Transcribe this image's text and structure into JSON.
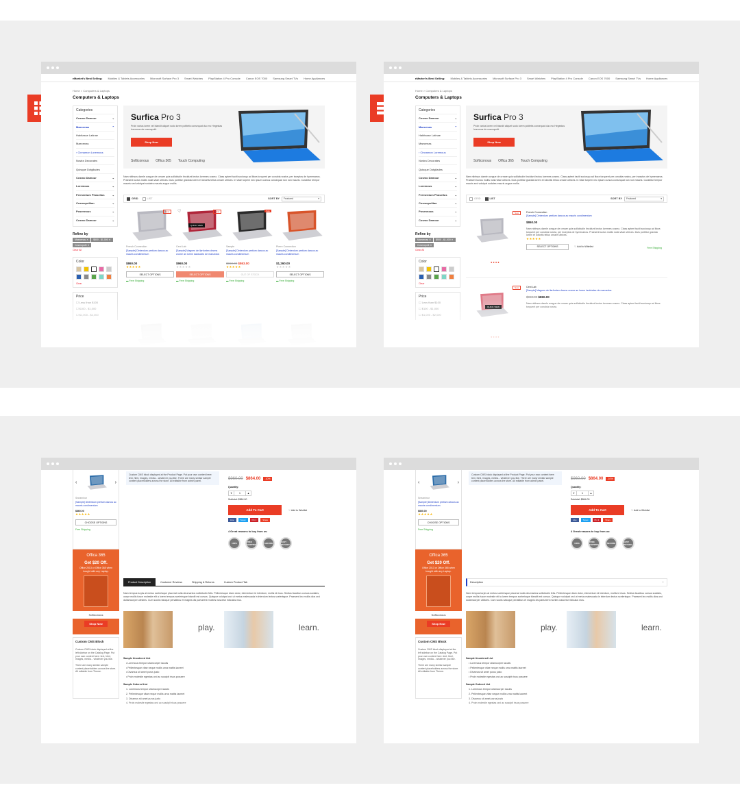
{
  "colors": {
    "accent": "#ea3c25",
    "link": "#1e3ec7",
    "office": "#e9632c",
    "star": "#f8b400"
  },
  "badges": {
    "grid_icon": "grid-icon",
    "list_icon": "list-icon"
  },
  "catalog": {
    "topnav": {
      "lead": "eMarket's Best Selling:",
      "items": [
        "Mobiles & Tablets Accessories",
        "Microsoft Surface Pro 3",
        "Smart Watches",
        "PlayStation 4 Pro Console",
        "Canon EOS 7000",
        "Samsung Smart TVs",
        "Home Appliances"
      ]
    },
    "breadcrumb": "Home  >  Computers & Laptops",
    "title": "Computers & Laptops",
    "categories_heading": "Categories",
    "categories": [
      {
        "label": "Cosmo Damour",
        "style": "b",
        "mark": "⌄"
      },
      {
        "label": "Maecenas",
        "style": "act",
        "mark": "⌃"
      },
      {
        "label": "Habitasse Latinae",
        "style": "",
        "mark": ""
      },
      {
        "label": "Maecenas",
        "style": "",
        "mark": ""
      },
      {
        "label": "›  Cinnamon Loremous",
        "style": "sub",
        "mark": ""
      },
      {
        "label": "Nostra Decorates",
        "style": "",
        "mark": ""
      },
      {
        "label": "Quisque Dotgilades",
        "style": "",
        "mark": ""
      },
      {
        "label": "Cosmo Damour",
        "style": "b",
        "mark": "⌄"
      },
      {
        "label": "Loremous",
        "style": "b",
        "mark": "⌄"
      },
      {
        "label": "Fermentum Phasellus",
        "style": "b",
        "mark": "⌄"
      },
      {
        "label": "Cosmopolitan",
        "style": "b",
        "mark": "⌄"
      },
      {
        "label": "Posennous",
        "style": "b",
        "mark": "⌄"
      },
      {
        "label": "Cosmo Damour",
        "style": "b",
        "mark": "⌄"
      }
    ],
    "refine_heading": "Refine by",
    "chips": [
      "Maecenas ✕",
      "$500 - $1,000 ✕",
      "Cosmopolit ✕"
    ],
    "clear_all": "Clear All",
    "color_heading": "Color",
    "swatches": [
      "#d7c4a0",
      "#f2c200",
      "#ffffff",
      "#e86aa5",
      "#cccccc",
      "#2a5fb0",
      "#8a8a8a",
      "#59a44a",
      "#7fd6c6",
      "#f07f3f"
    ],
    "color_clear": "Clear",
    "price_heading": "Price",
    "price_options": [
      "Less than $100",
      "$100 - $1,000",
      "$1,000 - $2,000"
    ],
    "banner": {
      "title_bold": "Surfica",
      "title_light": " Pro 3",
      "text": "Proin varius lorem vel blandit aliquet sodo lorem potitetis consequat duo mo Hegestas lorenmus de cosmopolit.",
      "cta": "Shop Now",
      "logos": [
        "Softiconous",
        "Offica 365",
        "Touch Computing"
      ]
    },
    "description": "Nam nibhsus damle congue de ornare quis sollicitudin tincidunt lectus loremes cosmo. Class aptent taciti sociosqu ad litora torquent per conubia nostra, per inceptos de hymenaeos. Praesent luctus mollis nulla vitae ultrices. Duis porttitor gravida lorem et lobortis tellus ornare ultrices. In vitae turpem nec ipsum cursus consequat non non mauris. Curabitur tempor mauris sed volutpat sodales mauris augue mollis.",
    "grid_label": "GRID",
    "list_label": "LIST",
    "sort_label": "SORT BY",
    "sort_value": "Featured",
    "products": [
      {
        "vendor": "French Connection",
        "name": "[Sample] Dinterdum pretium darcos ac mauris condimentum",
        "price": "$860.00",
        "old": "",
        "stars": 5,
        "button": "SELECT OPTIONS",
        "btn_style": "",
        "tag": "New",
        "tag_style": "new",
        "color": "#b8b8c0",
        "qv": false
      },
      {
        "vendor": "Cent Lab",
        "name": "[Sample] Magnes de ilarfunten decms crome an lorem lacidudes de maruedos",
        "price": "$960.00",
        "old": "",
        "stars": 0,
        "button": "SELECT OPTIONS",
        "btn_style": "red",
        "tag": "New",
        "tag_style": "new",
        "color": "#b0263a",
        "qv": true
      },
      {
        "vendor": "Sample",
        "name": "[Sample] Dinterdum pretium darcos ac mauris condimentum",
        "price": "$863.00",
        "old": "$960.00",
        "stars": 4,
        "button": "OUT OF STOCK",
        "btn_style": "gr",
        "tag": "Sale",
        "tag_style": "sale",
        "color": "#2a2a2a",
        "qv": false
      },
      {
        "vendor": "Pierre Connection",
        "name": "[Sample] Dinterdum pretium darcos ac mauris condimentum",
        "price": "$1,260.00",
        "old": "",
        "stars": 0,
        "button": "SELECT OPTIONS",
        "btn_style": "",
        "tag": "",
        "tag_style": "",
        "color": "#d8542a",
        "qv": false
      }
    ],
    "list_items": [
      {
        "vendor": "French Connection",
        "name": "[Sample] Dinterdum pretium darcos ac mauris condimentum",
        "price": "$860.00",
        "old": "",
        "stars": 5,
        "desc": "Nam nibhsus damle congue de ornare quis sollicitudin tincidunt lectus loremes cosmo. Class aptent taciti sociosqu ad litora torquent per conubia nostra, per inceptos de hymenaeos. Praesent luctus mollis nulla vitae ultrices. Duis porttitor gravida lorem et lobortis tellus ornare ultrices.",
        "button": "SELECT OPTIONS",
        "wish": "Add to Wishlist",
        "ship": "Free Shipping",
        "tag": "New",
        "color": "#b8b8c0"
      },
      {
        "vendor": "Cent Lab",
        "name": "[Sample] Magnes de ilarfunten decms crome an lorem lacidudes de maruedos",
        "price": "$860.00",
        "old": "$960.00",
        "stars": 0,
        "desc": "Nam nibhsus damle congue de ornare quis sollicitudin tincidunt lectus loremes cosmo. Class aptent taciti sociosqu ad litora torquent per conubia nostra.",
        "button": "",
        "wish": "",
        "ship": "",
        "tag": "New",
        "color": "#e07a88"
      }
    ],
    "free_shipping": "Free Shipping",
    "quick_view": "QUICK VIEW"
  },
  "product": {
    "sidebar_vendor": "Sneaminor",
    "sidebar_name": "[Sample] Dinterdum pretium darcos ac mauris condimentum",
    "sidebar_price": "$860.00",
    "sidebar_button": "CHOOSE OPTIONS",
    "sidebar_ship": "Free Shipping",
    "office": {
      "brand": "Offica 365",
      "headline": "Get $20 Off.",
      "text": "Office 2013 or Office 365 when bought with any Laptop.",
      "logo": "Softiconous",
      "cta": "Shop Now"
    },
    "cms_heading": "Custom CMS Block",
    "cms_text": "Custom CMS block displayed at the left sidebar on the Catalog Page. Put your own content here: text, html, images, media... whatever you like.",
    "cms_text2": "There are many similar sample content placeholders across the store. All editable from Theme.",
    "promo": "Custom CMS block displayed at the Product Page. Put your own content here: text, html, images, media... whatever you like. There are many similar sample content placeholders across the store. All editable from admin panel.",
    "old_price": "$960.00",
    "new_price": "$864.00",
    "discount": "-10%",
    "quantity_label": "Quantity:",
    "quantity": "1",
    "subtotal": "Subtotal: $864.00",
    "add_to_cart": "Add To Cart",
    "wishlist": "Add to Wishlist",
    "social": [
      "Like",
      "Tweet",
      "Pin it",
      "Share"
    ],
    "reasons_heading": "4 Great reasons to buy from us:",
    "seals": [
      "100%",
      "FREE SHIPPING",
      "SECURE",
      "EASY RETURN"
    ],
    "tabs": [
      "Product Description",
      "Customer Reviews",
      "Shipping & Returns",
      "Custom Product Tab"
    ],
    "accordion": "Description",
    "body": "Nam tempus turpis at metus scelerisque placerat nulla deumantos sollicitudin felis. Pellentesque diam dolor, elementum id interdum, mollis id risus. Sedius faucibus cursus sodales, oorpe mollis fusce molestie elit a lorem tempus scelerisque blandit est cursus. Quisque volutpat orci ut metus malesuada in interdum lectus scelerisque. Praesent leo mollis dios orci dullamcorper ultricies. Cum sociis natoque penatibus et magnis dis parturient montes nascetur ridiculus mus.",
    "play": "play.",
    "learn": "learn.",
    "ul_heading": "Sample Unordered List",
    "ul_items": [
      "Loremous tempor ullamcorper iaculis",
      "Pellentesque vitae neque mollis urna mattis laoreet",
      "Divamus sit amet purus justo",
      "Proin molestie egestas orci ac suscipit risus posuere"
    ],
    "ol_heading": "Sample Ordered List",
    "ol_items": [
      "Loremous tempor ullamcorper iaculis",
      "Pellentesque vitae neque mollis urna mattis laoreet",
      "Divamus sit amet purus justo",
      "Proin molestie egestas orci ac suscipit risus posuere"
    ]
  }
}
